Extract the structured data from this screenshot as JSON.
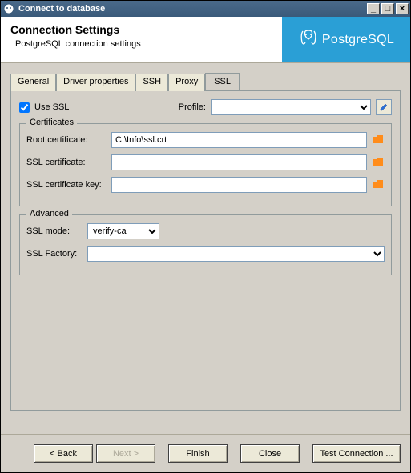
{
  "window": {
    "title": "Connect to database"
  },
  "header": {
    "title": "Connection Settings",
    "subtitle": "PostgreSQL connection settings",
    "brand": "PostgreSQL"
  },
  "tabs": {
    "general": "General",
    "driver": "Driver properties",
    "ssh": "SSH",
    "proxy": "Proxy",
    "ssl": "SSL"
  },
  "ssl": {
    "use_ssl_label": "Use SSL",
    "profile_label": "Profile:",
    "profile_value": "",
    "certs": {
      "legend": "Certificates",
      "root_label": "Root certificate:",
      "root_value": "C:\\Info\\ssl.crt",
      "cert_label": "SSL certificate:",
      "cert_value": "",
      "key_label": "SSL certificate key:",
      "key_value": ""
    },
    "advanced": {
      "legend": "Advanced",
      "mode_label": "SSL mode:",
      "mode_value": "verify-ca",
      "factory_label": "SSL Factory:",
      "factory_value": ""
    }
  },
  "footer": {
    "back": "< Back",
    "next": "Next >",
    "finish": "Finish",
    "close": "Close",
    "test": "Test Connection ..."
  }
}
